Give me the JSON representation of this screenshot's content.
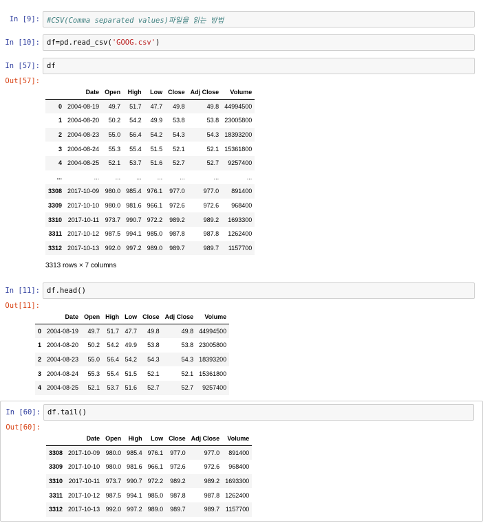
{
  "cells": {
    "c9": {
      "in_prompt": "In [9]:",
      "code": "#CSV(Comma separated values)파일을 읽는 방법"
    },
    "c10": {
      "in_prompt": "In [10]:",
      "code_prefix": "df=pd.read_csv(",
      "code_string": "'GOOG.csv'",
      "code_suffix": ")"
    },
    "c57": {
      "in_prompt": "In [57]:",
      "code": "df",
      "out_prompt": "Out[57]:",
      "summary": "3313 rows × 7 columns"
    },
    "c11": {
      "in_prompt": "In [11]:",
      "code": "df.head()",
      "out_prompt": "Out[11]:"
    },
    "c60": {
      "in_prompt": "In [60]:",
      "code": "df.tail()",
      "out_prompt": "Out[60]:"
    }
  },
  "columns": [
    "",
    "Date",
    "Open",
    "High",
    "Low",
    "Close",
    "Adj Close",
    "Volume"
  ],
  "head_rows": [
    [
      "0",
      "2004-08-19",
      "49.7",
      "51.7",
      "47.7",
      "49.8",
      "49.8",
      "44994500"
    ],
    [
      "1",
      "2004-08-20",
      "50.2",
      "54.2",
      "49.9",
      "53.8",
      "53.8",
      "23005800"
    ],
    [
      "2",
      "2004-08-23",
      "55.0",
      "56.4",
      "54.2",
      "54.3",
      "54.3",
      "18393200"
    ],
    [
      "3",
      "2004-08-24",
      "55.3",
      "55.4",
      "51.5",
      "52.1",
      "52.1",
      "15361800"
    ],
    [
      "4",
      "2004-08-25",
      "52.1",
      "53.7",
      "51.6",
      "52.7",
      "52.7",
      "9257400"
    ]
  ],
  "ellipsis_row": [
    "...",
    "...",
    "...",
    "...",
    "...",
    "...",
    "...",
    "..."
  ],
  "tail_rows": [
    [
      "3308",
      "2017-10-09",
      "980.0",
      "985.4",
      "976.1",
      "977.0",
      "977.0",
      "891400"
    ],
    [
      "3309",
      "2017-10-10",
      "980.0",
      "981.6",
      "966.1",
      "972.6",
      "972.6",
      "968400"
    ],
    [
      "3310",
      "2017-10-11",
      "973.7",
      "990.7",
      "972.2",
      "989.2",
      "989.2",
      "1693300"
    ],
    [
      "3311",
      "2017-10-12",
      "987.5",
      "994.1",
      "985.0",
      "987.8",
      "987.8",
      "1262400"
    ],
    [
      "3312",
      "2017-10-13",
      "992.0",
      "997.2",
      "989.0",
      "989.7",
      "989.7",
      "1157700"
    ]
  ],
  "colors": {
    "in_prompt": "#303f9f",
    "out_prompt": "#d84315",
    "input_bg": "#f7f7f7",
    "border": "#cfcfcf",
    "row_stripe": "#f5f5f5"
  }
}
